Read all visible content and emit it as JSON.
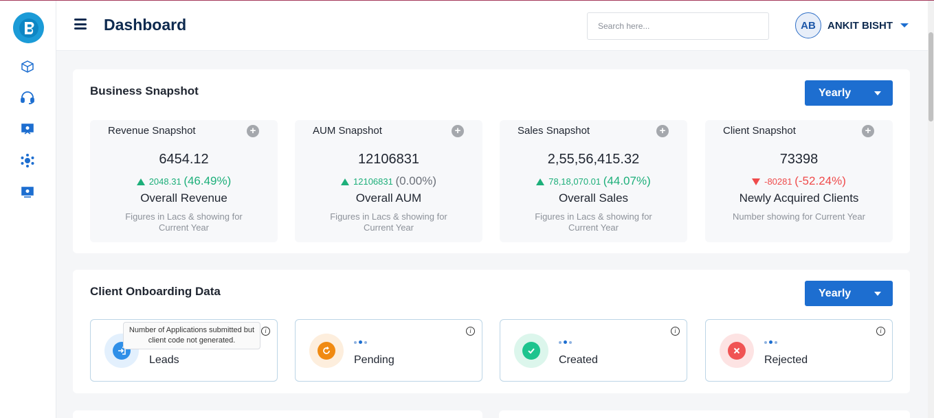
{
  "app": {
    "page_title": "Dashboard",
    "logo_letter": "B"
  },
  "sidebar": {
    "items": [
      {
        "icon": "cube-icon"
      },
      {
        "icon": "headset-icon"
      },
      {
        "icon": "presentation-icon"
      },
      {
        "icon": "network-icon"
      },
      {
        "icon": "monitor-icon"
      }
    ]
  },
  "header": {
    "search_placeholder": "Search here...",
    "user_initials": "AB",
    "user_name": "ANKIT BISHT"
  },
  "business_snapshot": {
    "title": "Business Snapshot",
    "period": "Yearly",
    "cards": [
      {
        "title": "Revenue Snapshot",
        "value": "6454.12",
        "change": "2048.31",
        "percent": "(46.49%)",
        "direction": "up",
        "label": "Overall Revenue",
        "note": "Figures in Lacs & showing for Current Year"
      },
      {
        "title": "AUM Snapshot",
        "value": "12106831",
        "change": "12106831",
        "percent": "(0.00%)",
        "direction": "up",
        "label": "Overall AUM",
        "note": "Figures in Lacs & showing for Current Year"
      },
      {
        "title": "Sales Snapshot",
        "value": "2,55,56,415.32",
        "change": "78,18,070.01",
        "percent": "(44.07%)",
        "direction": "up",
        "label": "Overall Sales",
        "note": "Figures in Lacs & showing for Current Year"
      },
      {
        "title": "Client Snapshot",
        "value": "73398",
        "change": "-80281",
        "percent": "(-52.24%)",
        "direction": "down",
        "label": "Newly Acquired Clients",
        "note": "Number showing for Current Year"
      }
    ]
  },
  "client_onboarding": {
    "title": "Client Onboarding Data",
    "period": "Yearly",
    "tooltip": "Number of Applications submitted but client code not generated.",
    "cards": [
      {
        "label": "Leads",
        "icon": "login-icon",
        "color": "#2f8fe8",
        "bg": "#e3f0fd"
      },
      {
        "label": "Pending",
        "icon": "refresh-icon",
        "color": "#f08a12",
        "bg": "#fdeedd"
      },
      {
        "label": "Created",
        "icon": "check-icon",
        "color": "#1dc48e",
        "bg": "#dcf6ec"
      },
      {
        "label": "Rejected",
        "icon": "close-icon",
        "color": "#f05454",
        "bg": "#fde3e3"
      }
    ]
  },
  "colors": {
    "primary": "#1d6ed0",
    "navy": "#0e2a4f",
    "up": "#1daf7a",
    "down": "#ef4b4b"
  }
}
